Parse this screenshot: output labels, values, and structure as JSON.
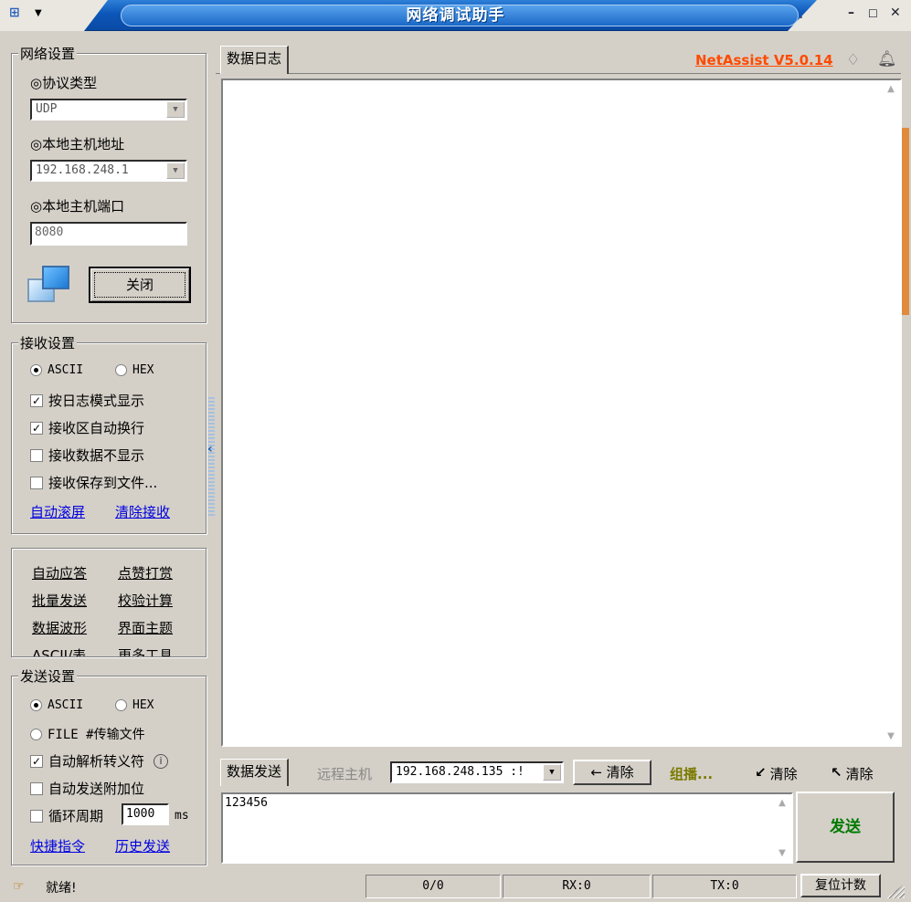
{
  "window": {
    "title": "网络调试助手",
    "version_link": "NetAssist V5.0.14",
    "system_icon": "app-menu-icon",
    "controls": [
      "pin",
      "minimize",
      "maximize",
      "close"
    ]
  },
  "network_settings": {
    "title": "网络设置",
    "protocol_label": "◎协议类型",
    "protocol_value": "UDP",
    "local_host_label": "◎本地主机地址",
    "local_host_value": "192.168.248.1",
    "local_port_label": "◎本地主机端口",
    "local_port_value": "8080",
    "close_button": "关闭"
  },
  "receive_settings": {
    "title": "接收设置",
    "ascii": "ASCII",
    "hex": "HEX",
    "log_mode": "按日志模式显示",
    "auto_wrap": "接收区自动换行",
    "hide_data": "接收数据不显示",
    "save_to_file": "接收保存到文件...",
    "auto_scroll": "自动滚屏",
    "clear_receive": "清除接收"
  },
  "tools": {
    "auto_reply": "自动应答",
    "donate": "点赞打赏",
    "batch_send": "批量发送",
    "checksum": "校验计算",
    "waveform": "数据波形",
    "theme": "界面主题",
    "ascii_table": "ASCII/表",
    "more_tools": "更多工具"
  },
  "send_settings": {
    "title": "发送设置",
    "ascii": "ASCII",
    "hex": "HEX",
    "file": "FILE #传输文件",
    "parse_escape": "自动解析转义符",
    "append_check": "自动发送附加位",
    "cycle_period": "循环周期",
    "cycle_value": "1000",
    "cycle_unit": "ms",
    "shortcut": "快捷指令",
    "history": "历史发送"
  },
  "data_log": {
    "tab": "数据日志"
  },
  "send_bar": {
    "tab": "数据发送",
    "remote_host_label": "远程主机",
    "remote_host_value": "192.168.248.135 :!",
    "clear_btn": "清除",
    "group_label": "组播...",
    "clear1": "清除",
    "clear2": "清除",
    "message": "123456",
    "send_button": "发送"
  },
  "status": {
    "ready": "就绪!",
    "count": "0/0",
    "rx": "RX:0",
    "tx": "TX:0",
    "reset": "复位计数"
  },
  "colors": {
    "title_bar": "#0c56b8",
    "version_link": "#ff4a00",
    "send_button": "#007a00",
    "group_label": "#7a7a00",
    "scroll_accent": "#e08a3c"
  }
}
